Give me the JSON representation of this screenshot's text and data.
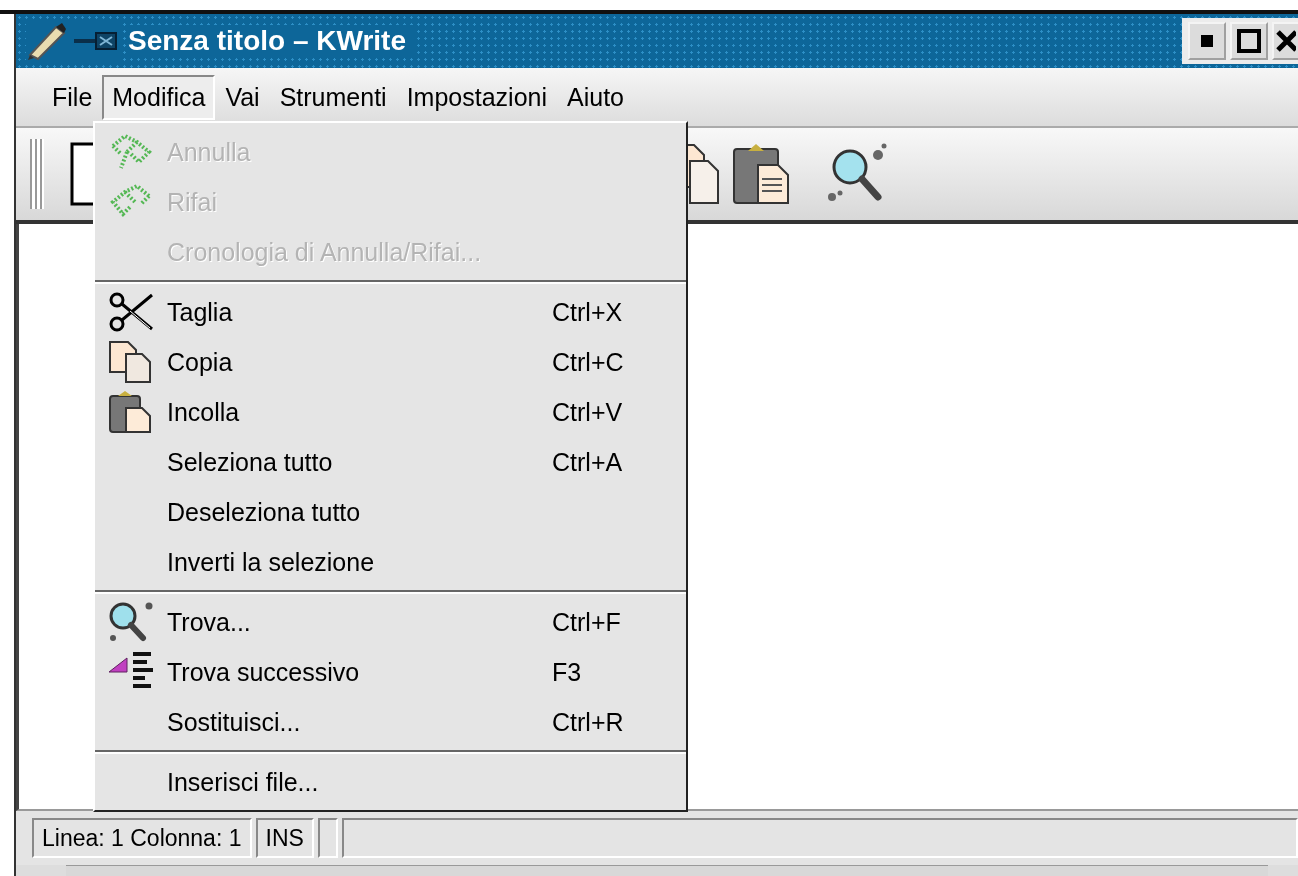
{
  "window": {
    "title": "Senza titolo – KWrite"
  },
  "menubar": [
    {
      "label": "File",
      "selected": false
    },
    {
      "label": "Modifica",
      "selected": true
    },
    {
      "label": "Vai",
      "selected": false
    },
    {
      "label": "Strumenti",
      "selected": false
    },
    {
      "label": "Impostazioni",
      "selected": false
    },
    {
      "label": "Aiuto",
      "selected": false
    }
  ],
  "edit_menu": {
    "groups": [
      {
        "items": [
          {
            "label": "Annulla",
            "kind": "undo",
            "disabled": true
          },
          {
            "label": "Rifai",
            "kind": "redo",
            "disabled": true
          },
          {
            "label": "Cronologia di Annulla/Rifai...",
            "disabled": true
          }
        ]
      },
      {
        "items": [
          {
            "label": "Taglia",
            "kind": "cut",
            "shortcut": "Ctrl+X",
            "disabled": false
          },
          {
            "label": "Copia",
            "kind": "copy",
            "shortcut": "Ctrl+C",
            "disabled": false
          },
          {
            "label": "Incolla",
            "kind": "paste",
            "shortcut": "Ctrl+V",
            "disabled": false
          },
          {
            "label": "Seleziona tutto",
            "shortcut": "Ctrl+A",
            "disabled": false
          },
          {
            "label": "Deseleziona tutto",
            "disabled": false
          },
          {
            "label": "Inverti la selezione",
            "disabled": false
          }
        ]
      },
      {
        "items": [
          {
            "label": "Trova...",
            "kind": "find",
            "shortcut": "Ctrl+F",
            "disabled": false
          },
          {
            "label": "Trova successivo",
            "kind": "find-next",
            "shortcut": "F3",
            "disabled": false
          },
          {
            "label": "Sostituisci...",
            "shortcut": "Ctrl+R",
            "disabled": false
          }
        ]
      },
      {
        "items": [
          {
            "label": "Inserisci file...",
            "disabled": false
          }
        ]
      }
    ]
  },
  "status_bar": {
    "fields": [
      "Linea: 1 Colonna: 1",
      "INS"
    ]
  }
}
